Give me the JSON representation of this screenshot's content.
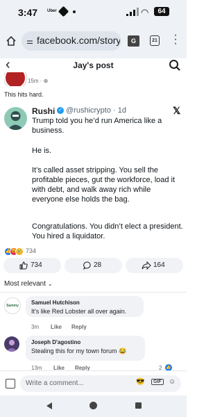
{
  "status": {
    "time": "3:47",
    "battery": "64",
    "carrier_icon_text": "Uber"
  },
  "browser": {
    "url": "facebook.com/story.p",
    "tabs_count": "21"
  },
  "header": {
    "title": "Jay's post"
  },
  "post": {
    "time": "15m",
    "caption": "This hits hard."
  },
  "tweet": {
    "name": "Rushi",
    "handle": "@rushicrypto · 1d",
    "paragraphs": [
      "Trump told you he’d run America like a business.",
      "He is.",
      "It’s called asset stripping. You sell the profitable pieces, gut the workforce, load it with debt, and walk away rich while everyone else holds the bag.",
      "Congratulations. You didn’t elect a president. You hired a liquidator."
    ]
  },
  "reactions": {
    "count": "734"
  },
  "actions": {
    "likes": "734",
    "comments": "28",
    "shares": "164"
  },
  "sort": {
    "label": "Most relevant"
  },
  "comments": [
    {
      "author": "Samuel Hutchison",
      "text": "It's like Red Lobster all over again.",
      "time": "3m",
      "like": "Like",
      "reply": "Reply",
      "avatar_text": "Sammy"
    },
    {
      "author": "Joseph D'agostino",
      "text": "Stealing this for my town forum 😂",
      "time": "13m",
      "like": "Like",
      "reply": "Reply",
      "reactions": "2"
    }
  ],
  "composer": {
    "placeholder": "Write a comment...",
    "gif": "GIF"
  },
  "colors": {
    "accent": "#1877f2",
    "verified": "#1d9bf0",
    "bubble": "#f0f2f5"
  }
}
